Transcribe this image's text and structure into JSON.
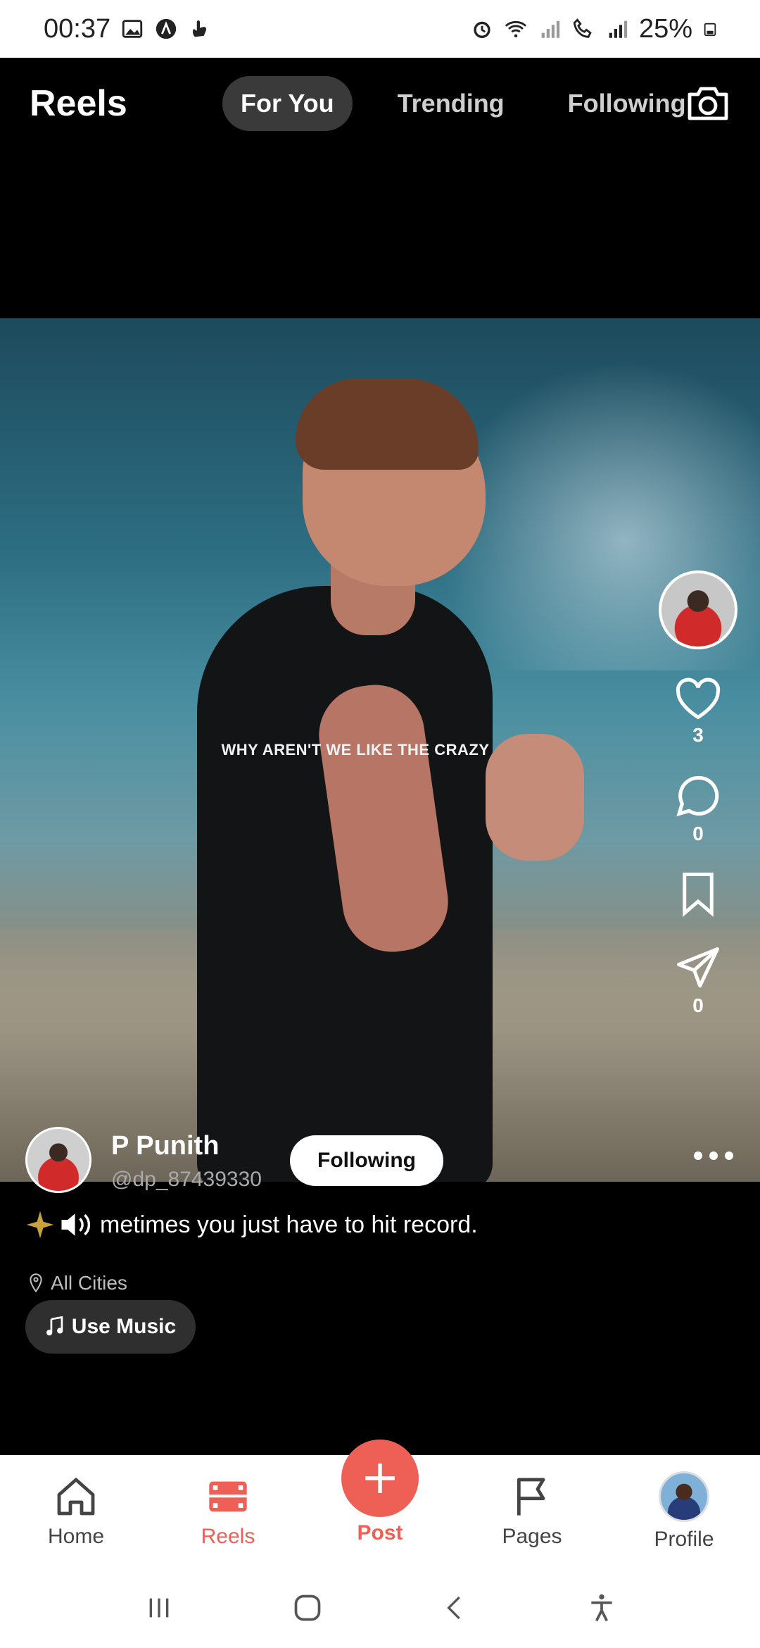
{
  "status_bar": {
    "time": "00:37",
    "battery": "25%"
  },
  "header": {
    "title": "Reels",
    "tabs": [
      {
        "label": "For You",
        "active": true
      },
      {
        "label": "Trending",
        "active": false
      },
      {
        "label": "Following",
        "active": false
      }
    ]
  },
  "video": {
    "overlay_text": "WHY AREN'T WE LIKE THE CRAZY"
  },
  "actions": {
    "likes": "3",
    "comments": "0",
    "shares": "0"
  },
  "post": {
    "author_name": "P Punith",
    "author_handle": "@dp_87439330",
    "follow_label": "Following",
    "caption": "metimes you just have to hit record.",
    "location": "All Cities",
    "use_music_label": "Use Music"
  },
  "bottom_nav": {
    "home": "Home",
    "reels": "Reels",
    "post": "Post",
    "pages": "Pages",
    "profile": "Profile"
  },
  "colors": {
    "accent": "#ee5f55",
    "background": "#000000",
    "tab_active_bg": "#3a3a3a"
  }
}
